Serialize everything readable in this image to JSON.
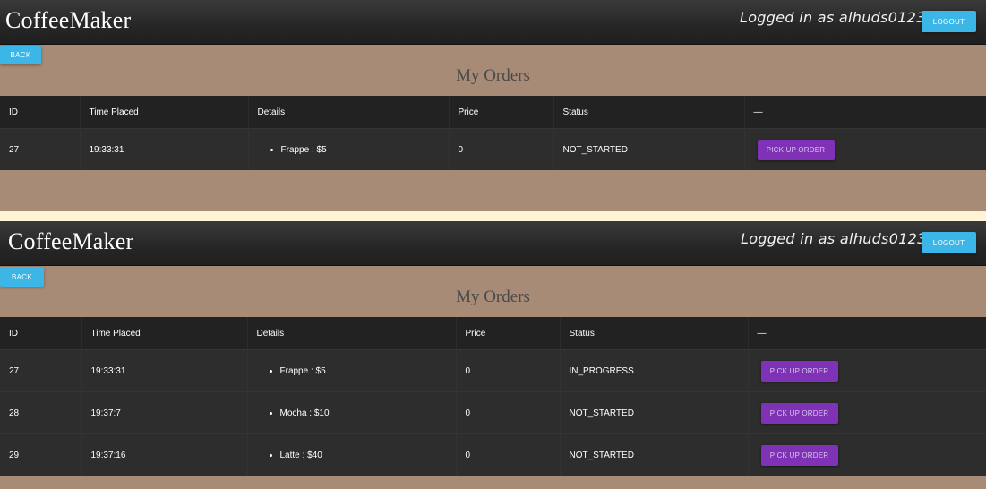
{
  "app": {
    "brand": "CoffeeMaker",
    "logged_in": "Logged in as alhuds0123",
    "logout_label": "LOGOUT",
    "back_label": "BACK",
    "page_title": "My Orders"
  },
  "table_headers": {
    "id": "ID",
    "time": "Time Placed",
    "details": "Details",
    "price": "Price",
    "status": "Status",
    "action": "—"
  },
  "panel1": {
    "orders": [
      {
        "id": "27",
        "time": "19:33:31",
        "detail": "Frappe : $5",
        "price": "0",
        "status": "NOT_STARTED",
        "action": "PICK UP ORDER"
      }
    ]
  },
  "panel2": {
    "orders": [
      {
        "id": "27",
        "time": "19:33:31",
        "detail": "Frappe : $5",
        "price": "0",
        "status": "IN_PROGRESS",
        "action": "PICK UP ORDER"
      },
      {
        "id": "28",
        "time": "19:37:7",
        "detail": "Mocha : $10",
        "price": "0",
        "status": "NOT_STARTED",
        "action": "PICK UP ORDER"
      },
      {
        "id": "29",
        "time": "19:37:16",
        "detail": "Latte : $40",
        "price": "0",
        "status": "NOT_STARTED",
        "action": "PICK UP ORDER"
      }
    ]
  },
  "colors": {
    "background": "#a88b76",
    "topbar": "#262626",
    "accent_blue": "#3bb6e6",
    "accent_purple": "#7f32b5",
    "divider": "#fff4d6"
  }
}
